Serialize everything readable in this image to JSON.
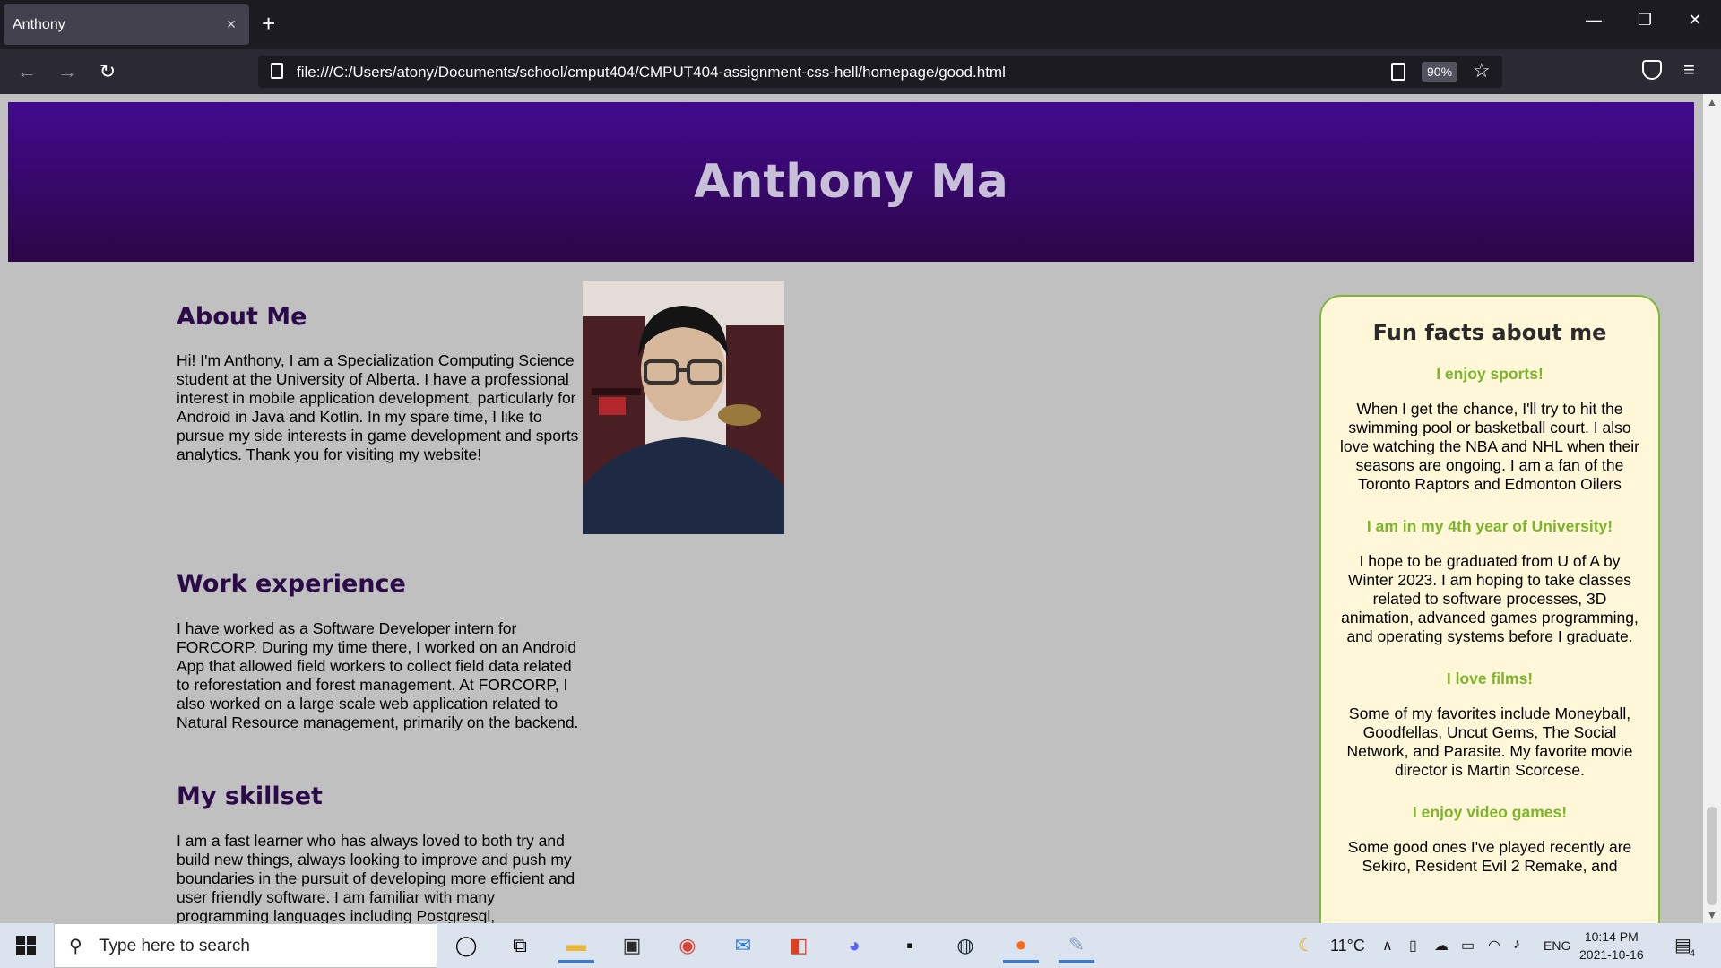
{
  "browser": {
    "tab_title": "Anthony",
    "tab_close": "×",
    "new_tab": "+",
    "url": "file:///C:/Users/atony/Documents/school/cmput404/CMPUT404-assignment-css-hell/homepage/good.html",
    "zoom": "90%",
    "window_controls": {
      "minimize": "—",
      "restore": "❐",
      "close": "✕"
    },
    "nav": {
      "back": "←",
      "forward": "→",
      "reload": "↻",
      "menu": "≡",
      "star": "☆"
    }
  },
  "page": {
    "name": "Anthony Ma",
    "about": {
      "title": "About Me",
      "text": "Hi! I'm Anthony, I am a Specialization Computing Science student at the University of Alberta. I have a professional interest in mobile application development, particularly for Android in Java and Kotlin. In my spare time, I like to pursue my side interests in game development and sports analytics. Thank you for visiting my website!"
    },
    "work": {
      "title": "Work experience",
      "text": "I have worked as a Software Developer intern for FORCORP. During my time there, I worked on an Android App that allowed field workers to collect field data related to reforestation and forest management. At FORCORP, I also worked on a large scale web application related to Natural Resource management, primarily on the backend."
    },
    "skills": {
      "title": "My skillset",
      "text": "I am a fast learner who has always loved to both try and build new things, always looking to improve and push my boundaries in the pursuit of developing more efficient and user friendly software. I am familiar with many programming languages including Postgresql,"
    },
    "fun_facts": {
      "title": "Fun facts about me",
      "items": [
        {
          "heading": "I enjoy sports!",
          "text": "When I get the chance, I'll try to hit the swimming pool or basketball court. I also love watching the NBA and NHL when their seasons are ongoing. I am a fan of the Toronto Raptors and Edmonton Oilers"
        },
        {
          "heading": "I am in my 4th year of University!",
          "text": "I hope to be graduated from U of A by Winter 2023. I am hoping to take classes related to software processes, 3D animation, advanced games programming, and operating systems before I graduate."
        },
        {
          "heading": "I love films!",
          "text": "Some of my favorites include Moneyball, Goodfellas, Uncut Gems, The Social Network, and Parasite. My favorite movie director is Martin Scorcese."
        },
        {
          "heading": "I enjoy video games!",
          "text": "Some good ones I've played recently are Sekiro, Resident Evil 2 Remake, and"
        }
      ]
    }
  },
  "taskbar": {
    "search_placeholder": "Type here to search",
    "weather": "11°C",
    "language": "ENG",
    "time": "10:14 PM",
    "date": "2021-10-16",
    "notifications": "4"
  }
}
